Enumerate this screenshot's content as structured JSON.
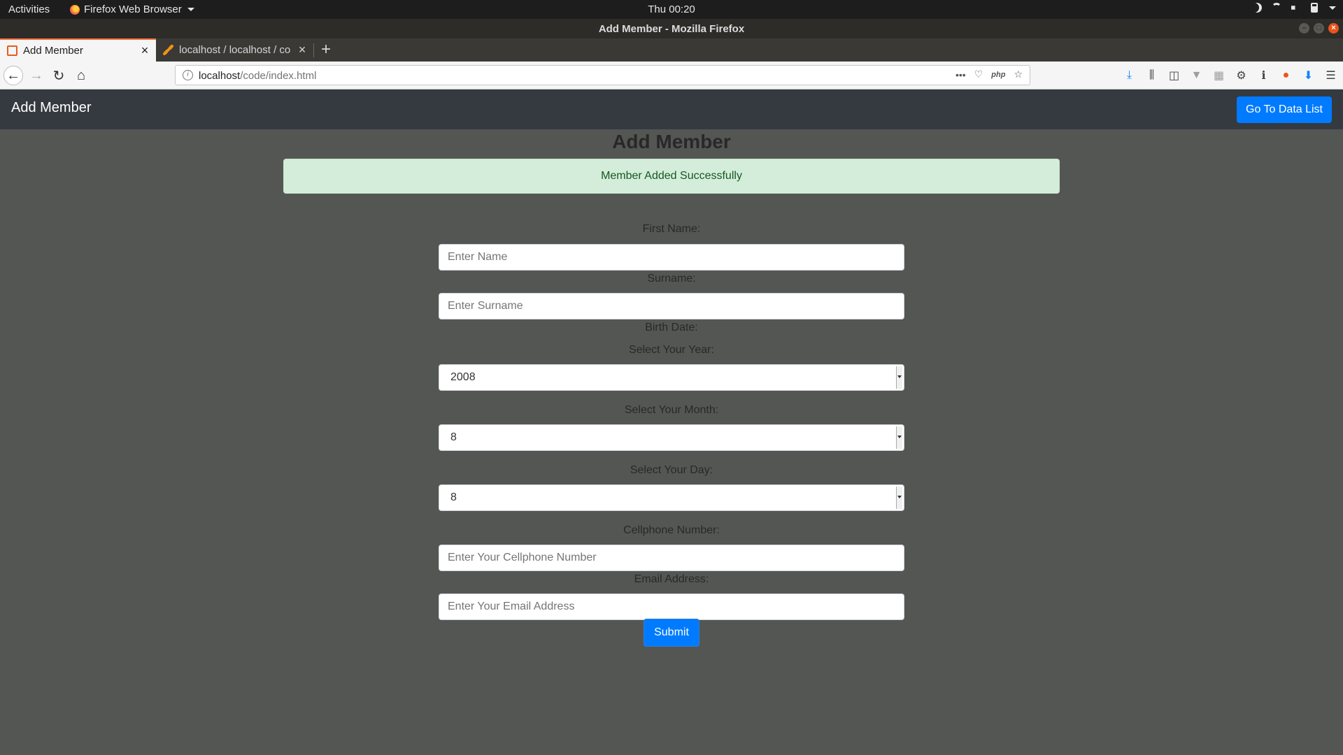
{
  "system_bar": {
    "activities": "Activities",
    "app_name": "Firefox Web Browser",
    "clock": "Thu 00:20"
  },
  "window": {
    "title": "Add Member - Mozilla Firefox"
  },
  "tabs": [
    {
      "label": "Add Member",
      "active": true
    },
    {
      "label": "localhost / localhost / co",
      "active": false
    }
  ],
  "toolbar": {
    "url_host": "localhost",
    "url_path": "/code/index.html",
    "php_label": "php"
  },
  "app": {
    "brand": "Add Member",
    "data_list_button": "Go To Data List",
    "page_title": "Add Member",
    "alert": "Member Added Successfully"
  },
  "form": {
    "first_name_label": "First Name:",
    "first_name_placeholder": "Enter Name",
    "surname_label": "Surname:",
    "surname_placeholder": "Enter Surname",
    "birth_date_label": "Birth Date:",
    "year_label": "Select Your Year:",
    "year_value": "2008",
    "month_label": "Select Your Month:",
    "month_value": "8",
    "day_label": "Select Your Day:",
    "day_value": "8",
    "cellphone_label": "Cellphone Number:",
    "cellphone_placeholder": "Enter Your Cellphone Number",
    "email_label": "Email Address:",
    "email_placeholder": "Enter Your Email Address",
    "submit_label": "Submit"
  },
  "colors": {
    "page_background": "#545654",
    "navbar": "#343a40",
    "primary_button": "#007bff",
    "alert_background": "#d4edda",
    "alert_text": "#155724"
  }
}
